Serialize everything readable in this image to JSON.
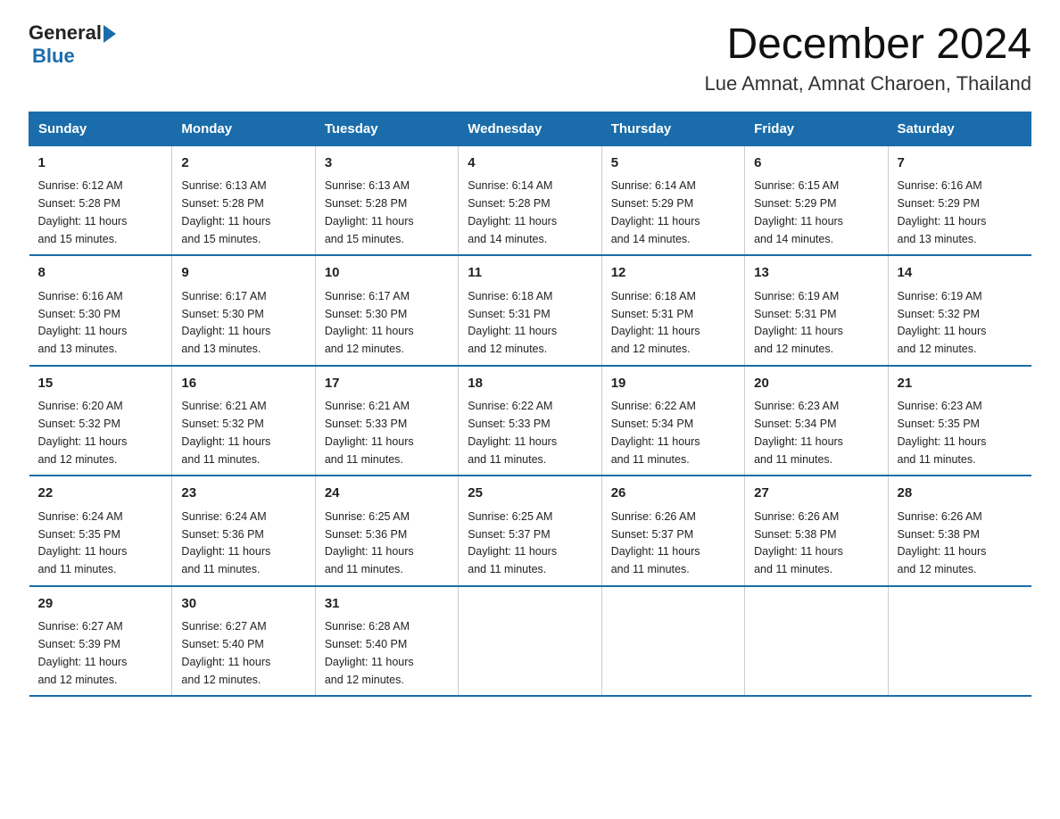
{
  "logo": {
    "general": "General",
    "blue": "Blue"
  },
  "title": "December 2024",
  "subtitle": "Lue Amnat, Amnat Charoen, Thailand",
  "days_of_week": [
    "Sunday",
    "Monday",
    "Tuesday",
    "Wednesday",
    "Thursday",
    "Friday",
    "Saturday"
  ],
  "weeks": [
    [
      {
        "day": "1",
        "sunrise": "6:12 AM",
        "sunset": "5:28 PM",
        "daylight": "11 hours and 15 minutes."
      },
      {
        "day": "2",
        "sunrise": "6:13 AM",
        "sunset": "5:28 PM",
        "daylight": "11 hours and 15 minutes."
      },
      {
        "day": "3",
        "sunrise": "6:13 AM",
        "sunset": "5:28 PM",
        "daylight": "11 hours and 15 minutes."
      },
      {
        "day": "4",
        "sunrise": "6:14 AM",
        "sunset": "5:28 PM",
        "daylight": "11 hours and 14 minutes."
      },
      {
        "day": "5",
        "sunrise": "6:14 AM",
        "sunset": "5:29 PM",
        "daylight": "11 hours and 14 minutes."
      },
      {
        "day": "6",
        "sunrise": "6:15 AM",
        "sunset": "5:29 PM",
        "daylight": "11 hours and 14 minutes."
      },
      {
        "day": "7",
        "sunrise": "6:16 AM",
        "sunset": "5:29 PM",
        "daylight": "11 hours and 13 minutes."
      }
    ],
    [
      {
        "day": "8",
        "sunrise": "6:16 AM",
        "sunset": "5:30 PM",
        "daylight": "11 hours and 13 minutes."
      },
      {
        "day": "9",
        "sunrise": "6:17 AM",
        "sunset": "5:30 PM",
        "daylight": "11 hours and 13 minutes."
      },
      {
        "day": "10",
        "sunrise": "6:17 AM",
        "sunset": "5:30 PM",
        "daylight": "11 hours and 12 minutes."
      },
      {
        "day": "11",
        "sunrise": "6:18 AM",
        "sunset": "5:31 PM",
        "daylight": "11 hours and 12 minutes."
      },
      {
        "day": "12",
        "sunrise": "6:18 AM",
        "sunset": "5:31 PM",
        "daylight": "11 hours and 12 minutes."
      },
      {
        "day": "13",
        "sunrise": "6:19 AM",
        "sunset": "5:31 PM",
        "daylight": "11 hours and 12 minutes."
      },
      {
        "day": "14",
        "sunrise": "6:19 AM",
        "sunset": "5:32 PM",
        "daylight": "11 hours and 12 minutes."
      }
    ],
    [
      {
        "day": "15",
        "sunrise": "6:20 AM",
        "sunset": "5:32 PM",
        "daylight": "11 hours and 12 minutes."
      },
      {
        "day": "16",
        "sunrise": "6:21 AM",
        "sunset": "5:32 PM",
        "daylight": "11 hours and 11 minutes."
      },
      {
        "day": "17",
        "sunrise": "6:21 AM",
        "sunset": "5:33 PM",
        "daylight": "11 hours and 11 minutes."
      },
      {
        "day": "18",
        "sunrise": "6:22 AM",
        "sunset": "5:33 PM",
        "daylight": "11 hours and 11 minutes."
      },
      {
        "day": "19",
        "sunrise": "6:22 AM",
        "sunset": "5:34 PM",
        "daylight": "11 hours and 11 minutes."
      },
      {
        "day": "20",
        "sunrise": "6:23 AM",
        "sunset": "5:34 PM",
        "daylight": "11 hours and 11 minutes."
      },
      {
        "day": "21",
        "sunrise": "6:23 AM",
        "sunset": "5:35 PM",
        "daylight": "11 hours and 11 minutes."
      }
    ],
    [
      {
        "day": "22",
        "sunrise": "6:24 AM",
        "sunset": "5:35 PM",
        "daylight": "11 hours and 11 minutes."
      },
      {
        "day": "23",
        "sunrise": "6:24 AM",
        "sunset": "5:36 PM",
        "daylight": "11 hours and 11 minutes."
      },
      {
        "day": "24",
        "sunrise": "6:25 AM",
        "sunset": "5:36 PM",
        "daylight": "11 hours and 11 minutes."
      },
      {
        "day": "25",
        "sunrise": "6:25 AM",
        "sunset": "5:37 PM",
        "daylight": "11 hours and 11 minutes."
      },
      {
        "day": "26",
        "sunrise": "6:26 AM",
        "sunset": "5:37 PM",
        "daylight": "11 hours and 11 minutes."
      },
      {
        "day": "27",
        "sunrise": "6:26 AM",
        "sunset": "5:38 PM",
        "daylight": "11 hours and 11 minutes."
      },
      {
        "day": "28",
        "sunrise": "6:26 AM",
        "sunset": "5:38 PM",
        "daylight": "11 hours and 12 minutes."
      }
    ],
    [
      {
        "day": "29",
        "sunrise": "6:27 AM",
        "sunset": "5:39 PM",
        "daylight": "11 hours and 12 minutes."
      },
      {
        "day": "30",
        "sunrise": "6:27 AM",
        "sunset": "5:40 PM",
        "daylight": "11 hours and 12 minutes."
      },
      {
        "day": "31",
        "sunrise": "6:28 AM",
        "sunset": "5:40 PM",
        "daylight": "11 hours and 12 minutes."
      },
      null,
      null,
      null,
      null
    ]
  ],
  "labels": {
    "sunrise": "Sunrise:",
    "sunset": "Sunset:",
    "daylight": "Daylight:"
  }
}
